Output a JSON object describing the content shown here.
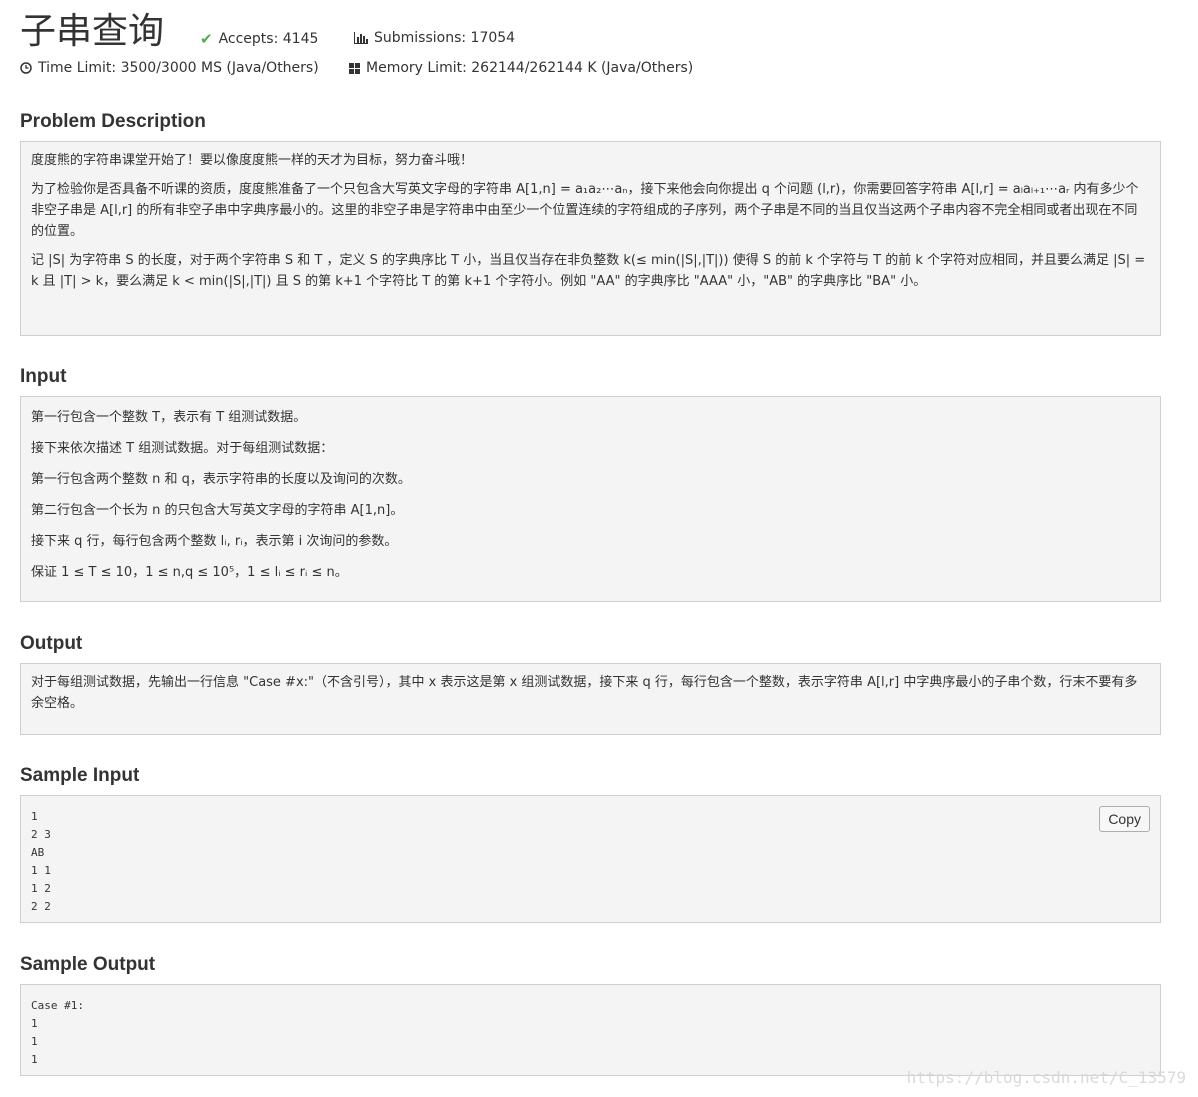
{
  "header": {
    "title": "子串查询",
    "accepts": "Accepts: 4145",
    "submissions": "Submissions: 17054",
    "time_limit": "Time Limit: 3500/3000 MS (Java/Others)",
    "memory_limit": "Memory Limit: 262144/262144 K (Java/Others)"
  },
  "description": {
    "title": "Problem Description",
    "p1": "度度熊的字符串课堂开始了！要以像度度熊一样的天才为目标，努力奋斗哦！",
    "p2": "为了检验你是否具备不听课的资质，度度熊准备了一个只包含大写英文字母的字符串 A[1,n] = a₁a₂⋯aₙ，接下来他会向你提出 q 个问题 (l,r)，你需要回答字符串 A[l,r] = aₗaₗ₊₁⋯aᵣ 内有多少个非空子串是 A[l,r] 的所有非空子串中字典序最小的。这里的非空子串是字符串中由至少一个位置连续的字符组成的子序列，两个子串是不同的当且仅当这两个子串内容不完全相同或者出现在不同的位置。",
    "p3": "记 |S| 为字符串 S 的长度，对于两个字符串 S 和 T ，定义 S 的字典序比 T 小，当且仅当存在非负整数 k(≤ min(|S|,|T|)) 使得 S 的前 k 个字符与 T 的前 k 个字符对应相同，并且要么满足 |S| = k 且 |T| > k，要么满足 k < min(|S|,|T|) 且 S 的第 k+1 个字符比 T 的第 k+1 个字符小。例如 \"AA\" 的字典序比 \"AAA\" 小，\"AB\" 的字典序比 \"BA\" 小。"
  },
  "input": {
    "title": "Input",
    "lines": [
      "第一行包含一个整数 T，表示有 T 组测试数据。",
      "接下来依次描述 T 组测试数据。对于每组测试数据：",
      "第一行包含两个整数 n 和 q，表示字符串的长度以及询问的次数。",
      "第二行包含一个长为 n 的只包含大写英文字母的字符串 A[1,n]。",
      "接下来 q 行，每行包含两个整数 lᵢ, rᵢ，表示第 i 次询问的参数。",
      "保证 1 ≤ T ≤ 10，1 ≤ n,q ≤ 10⁵，1 ≤ lᵢ ≤ rᵢ ≤ n。"
    ]
  },
  "output": {
    "title": "Output",
    "text": "对于每组测试数据，先输出一行信息 \"Case #x:\"（不含引号），其中 x 表示这是第 x 组测试数据，接下来 q 行，每行包含一个整数，表示字符串 A[l,r] 中字典序最小的子串个数，行末不要有多余空格。"
  },
  "sample_input": {
    "title": "Sample Input",
    "copy_label": "Copy",
    "text": "1\n2 3\nAB\n1 1\n1 2\n2 2"
  },
  "sample_output": {
    "title": "Sample Output",
    "text": "Case #1:\n1\n1\n1"
  },
  "watermark": "https://blog.csdn.net/C_13579"
}
